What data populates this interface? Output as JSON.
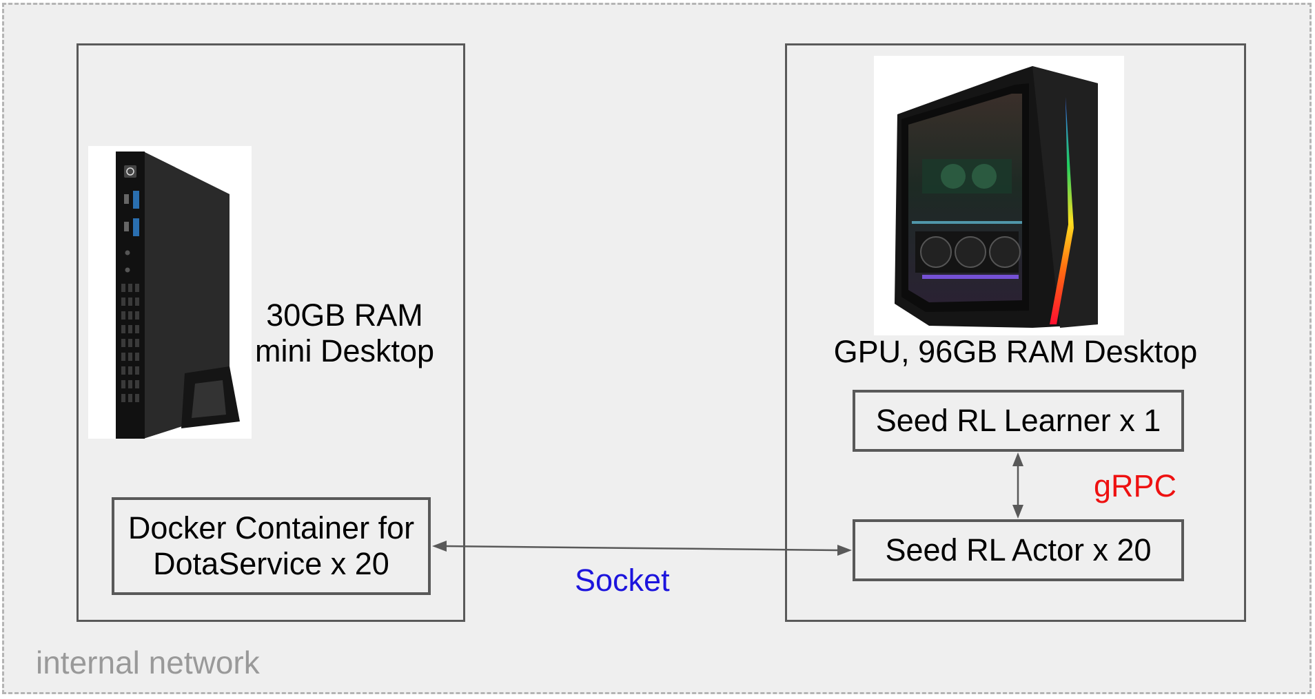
{
  "network": {
    "label": "internal network"
  },
  "mini_desktop": {
    "label_lines": [
      "30GB  RAM",
      "mini Desktop"
    ],
    "photo_icon": "mini-pc-image",
    "container_box": {
      "lines": [
        "Docker Container for",
        "DotaService x 20"
      ]
    }
  },
  "gpu_desktop": {
    "label": "GPU, 96GB RAM Desktop",
    "photo_icon": "gaming-tower-pc-image",
    "learner_box": "Seed RL Learner x 1",
    "actor_box": "Seed RL Actor x 20"
  },
  "connections": {
    "socket": "Socket",
    "grpc": "gRPC"
  },
  "colors": {
    "background": "#efefef",
    "border": "#595959",
    "network_border": "#b4b4b4",
    "socket_text": "#1c14dd",
    "grpc_text": "#ee1111"
  }
}
